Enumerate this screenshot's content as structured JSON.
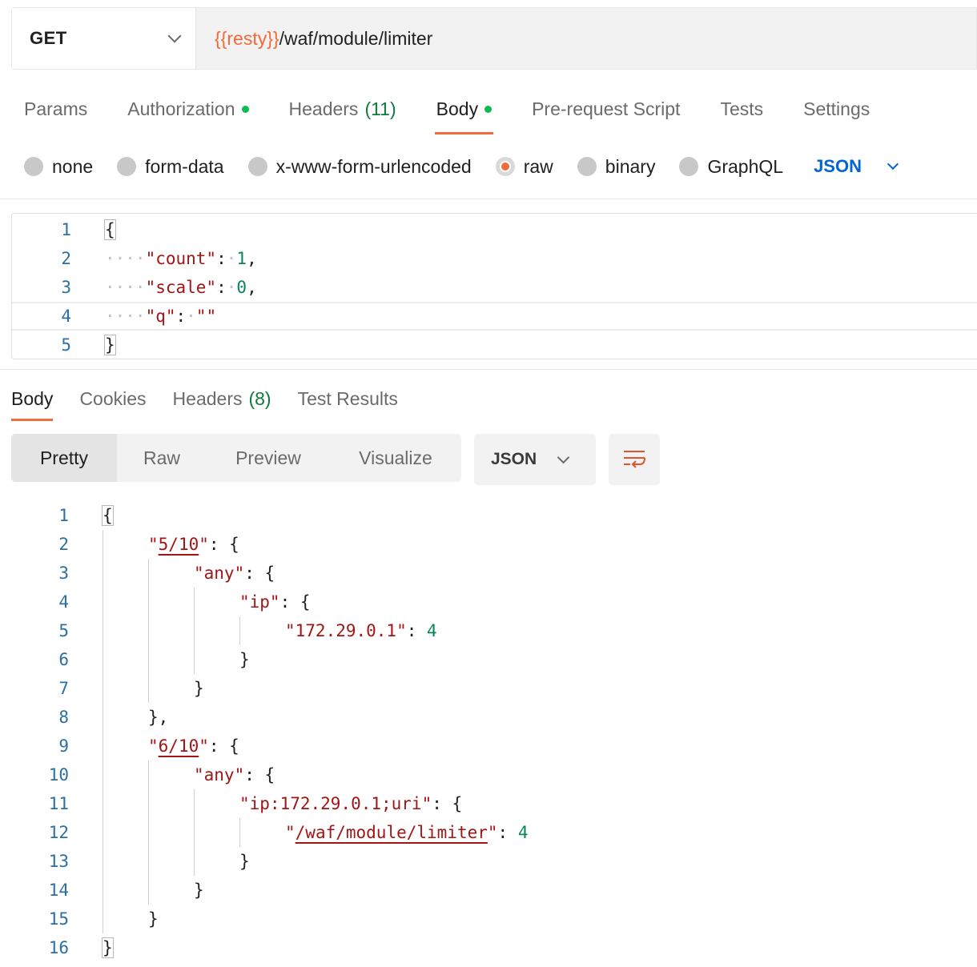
{
  "request": {
    "method": "GET",
    "url_variable": "{{resty}}",
    "url_path": "/waf/module/limiter"
  },
  "request_tabs": [
    {
      "label": "Params",
      "dot": false,
      "count": ""
    },
    {
      "label": "Authorization",
      "dot": true,
      "count": ""
    },
    {
      "label": "Headers",
      "dot": false,
      "count": "(11)"
    },
    {
      "label": "Body",
      "dot": true,
      "count": "",
      "active": true
    },
    {
      "label": "Pre-request Script",
      "dot": false,
      "count": ""
    },
    {
      "label": "Tests",
      "dot": false,
      "count": ""
    },
    {
      "label": "Settings",
      "dot": false,
      "count": ""
    }
  ],
  "body_types": {
    "none": "none",
    "form_data": "form-data",
    "urlencoded": "x-www-form-urlencoded",
    "raw": "raw",
    "binary": "binary",
    "graphql": "GraphQL",
    "selected": "raw",
    "language": "JSON"
  },
  "request_body": {
    "line_numbers": [
      "1",
      "2",
      "3",
      "4",
      "5"
    ],
    "open_brace": "{",
    "close_brace": "}",
    "count_key": "\"count\"",
    "count_value": "1",
    "scale_key": "\"scale\"",
    "scale_value": "0",
    "q_key": "\"q\"",
    "q_value": "\"\""
  },
  "response_tabs": {
    "body": "Body",
    "cookies": "Cookies",
    "headers": "Headers",
    "headers_count": "(8)",
    "test_results": "Test Results"
  },
  "view_modes": {
    "pretty": "Pretty",
    "raw": "Raw",
    "preview": "Preview",
    "visualize": "Visualize",
    "format": "JSON"
  },
  "response_body": {
    "line_numbers": [
      "1",
      "2",
      "3",
      "4",
      "5",
      "6",
      "7",
      "8",
      "9",
      "10",
      "11",
      "12",
      "13",
      "14",
      "15",
      "16"
    ],
    "key_5_10_open": "\"",
    "key_5_10": "5/10",
    "key_close": "\"",
    "any": "\"any\"",
    "ip": "\"ip\"",
    "ip_address_key": "\"172.29.0.1\"",
    "ip_value": "4",
    "key_6_10": "6/10",
    "ip_uri_key": "\"ip:172.29.0.1;uri\"",
    "uri_path": "/waf/module/limiter",
    "uri_value": "4"
  },
  "colors": {
    "accent": "#f26b3a",
    "green_dot": "#0cbb52",
    "link_blue": "#0265d2",
    "string": "#a31515",
    "number": "#098658"
  }
}
